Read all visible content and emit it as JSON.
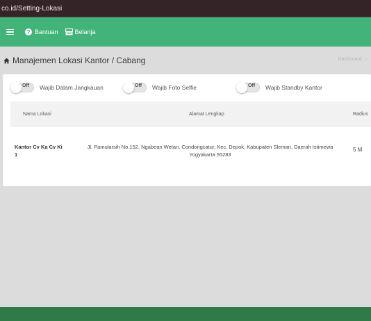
{
  "browser": {
    "url": "co.id/Setting-Lokasi"
  },
  "topnav": {
    "help_label": "Bantuan",
    "shop_label": "Belanja",
    "help_icon_glyph": "?",
    "accent_color": "#42b47a"
  },
  "page": {
    "title": "Manajemen Lokasi Kantor / Cabang",
    "breadcrumb": "Dashboard",
    "breadcrumb_chevron": "›"
  },
  "toggles": [
    {
      "state": "Off",
      "label": "Wajib Dalam Jangkauan"
    },
    {
      "state": "Off",
      "label": "Wajib Foto Selfie"
    },
    {
      "state": "Off",
      "label": "Wajib Standby Kantor"
    }
  ],
  "table": {
    "columns": [
      "Nama Lokasi",
      "Alamat Lengkap",
      "Radius"
    ],
    "rows": [
      {
        "name": "Kantor Cv Ka Cv Ki 1",
        "address": "Jl. Pamularsih No.152, Ngabean Wetan, Condongcatur, Kec. Depok, Kabupaten Sleman, Daerah Istimewa Yogyakarta 55283",
        "radius": "5 M"
      }
    ]
  },
  "colors": {
    "url_bar": "#342427",
    "footer": "#2e7b48",
    "background": "#dcdcdc"
  }
}
